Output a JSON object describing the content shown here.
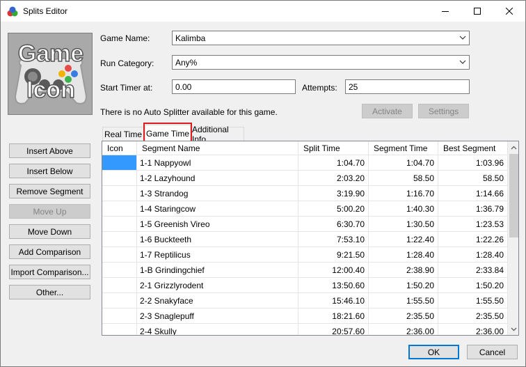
{
  "window": {
    "title": "Splits Editor"
  },
  "game_icon": {
    "line1": "Game",
    "line2": "Icon"
  },
  "form": {
    "game_name_label": "Game Name:",
    "game_name_value": "Kalimba",
    "run_category_label": "Run Category:",
    "run_category_value": "Any%",
    "start_timer_label": "Start Timer at:",
    "start_timer_value": "0.00",
    "attempts_label": "Attempts:",
    "attempts_value": "25",
    "autosplitter_message": "There is no Auto Splitter available for this game.",
    "activate_label": "Activate",
    "settings_label": "Settings"
  },
  "tabs": [
    {
      "label": "Real Time"
    },
    {
      "label": "Game Time"
    },
    {
      "label": "Additional Info"
    }
  ],
  "side_buttons": {
    "insert_above": "Insert Above",
    "insert_below": "Insert Below",
    "remove_segment": "Remove Segment",
    "move_up": "Move Up",
    "move_down": "Move Down",
    "add_comparison": "Add Comparison",
    "import_comparison": "Import Comparison...",
    "other": "Other..."
  },
  "table": {
    "columns": [
      "Icon",
      "Segment Name",
      "Split Time",
      "Segment Time",
      "Best Segment"
    ],
    "rows": [
      [
        "",
        "1-1 Nappyowl",
        "1:04.70",
        "1:04.70",
        "1:03.96"
      ],
      [
        "",
        "1-2 Lazyhound",
        "2:03.20",
        "58.50",
        "58.50"
      ],
      [
        "",
        "1-3 Strandog",
        "3:19.90",
        "1:16.70",
        "1:14.66"
      ],
      [
        "",
        "1-4 Staringcow",
        "5:00.20",
        "1:40.30",
        "1:36.79"
      ],
      [
        "",
        "1-5 Greenish Vireo",
        "6:30.70",
        "1:30.50",
        "1:23.53"
      ],
      [
        "",
        "1-6 Buckteeth",
        "7:53.10",
        "1:22.40",
        "1:22.26"
      ],
      [
        "",
        "1-7 Reptilicus",
        "9:21.50",
        "1:28.40",
        "1:28.40"
      ],
      [
        "",
        "1-B Grindingchief",
        "12:00.40",
        "2:38.90",
        "2:33.84"
      ],
      [
        "",
        "2-1 Grizzlyrodent",
        "13:50.60",
        "1:50.20",
        "1:50.20"
      ],
      [
        "",
        "2-2 Snakyface",
        "15:46.10",
        "1:55.50",
        "1:55.50"
      ],
      [
        "",
        "2-3 Snaglepuff",
        "18:21.60",
        "2:35.50",
        "2:35.50"
      ],
      [
        "",
        "2-4 Skully",
        "20:57.60",
        "2:36.00",
        "2:36.00"
      ]
    ]
  },
  "footer": {
    "ok_label": "OK",
    "cancel_label": "Cancel"
  },
  "colors": {
    "selection": "#3399ff",
    "tab_highlight": "#e01b1b",
    "default_button_border": "#0078d7"
  }
}
